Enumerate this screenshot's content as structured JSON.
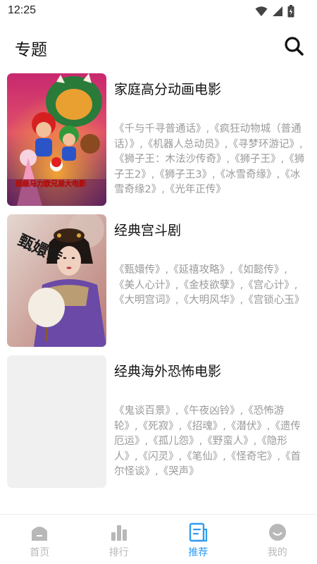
{
  "status": {
    "time": "12:25"
  },
  "header": {
    "title": "专题"
  },
  "topics": [
    {
      "title": "家庭高分动画电影",
      "desc": "《千与千寻普通话》,《疯狂动物城（普通话）》,《机器人总动员》,《寻梦环游记》,《狮子王：木法沙传奇》,《狮子王》,《狮子王2》,《狮子王3》,《冰雪奇缘》,《冰雪奇缘2》,《光年正传》",
      "poster_text": "超级马力欧兄弟大电影"
    },
    {
      "title": "经典宫斗剧",
      "desc": "《甄嬛传》,《延禧攻略》,《如懿传》,《美人心计》,《金枝欲孽》,《宫心计》,《大明宫词》,《大明风华》,《宫锁心玉》",
      "poster_text": "甄嬛传"
    },
    {
      "title": "经典海外恐怖电影",
      "desc": "《鬼谈百景》,《午夜凶铃》,《恐怖游轮》,《死寂》,《招魂》,《潜伏》,《遗传厄运》,《孤儿怨》,《野蛮人》,《隐形人》,《闪灵》,《笔仙》,《怪奇宅》,《首尔怪谈》,《哭声》",
      "poster_text": ""
    }
  ],
  "tabs": [
    {
      "label": "首页",
      "icon": "home-icon"
    },
    {
      "label": "排行",
      "icon": "ranking-icon"
    },
    {
      "label": "推荐",
      "icon": "recommend-icon"
    },
    {
      "label": "我的",
      "icon": "profile-icon"
    }
  ],
  "colors": {
    "accent": "#2f9cf0",
    "inactive": "#b8b8b8",
    "desc_text": "#9a9a9a"
  }
}
